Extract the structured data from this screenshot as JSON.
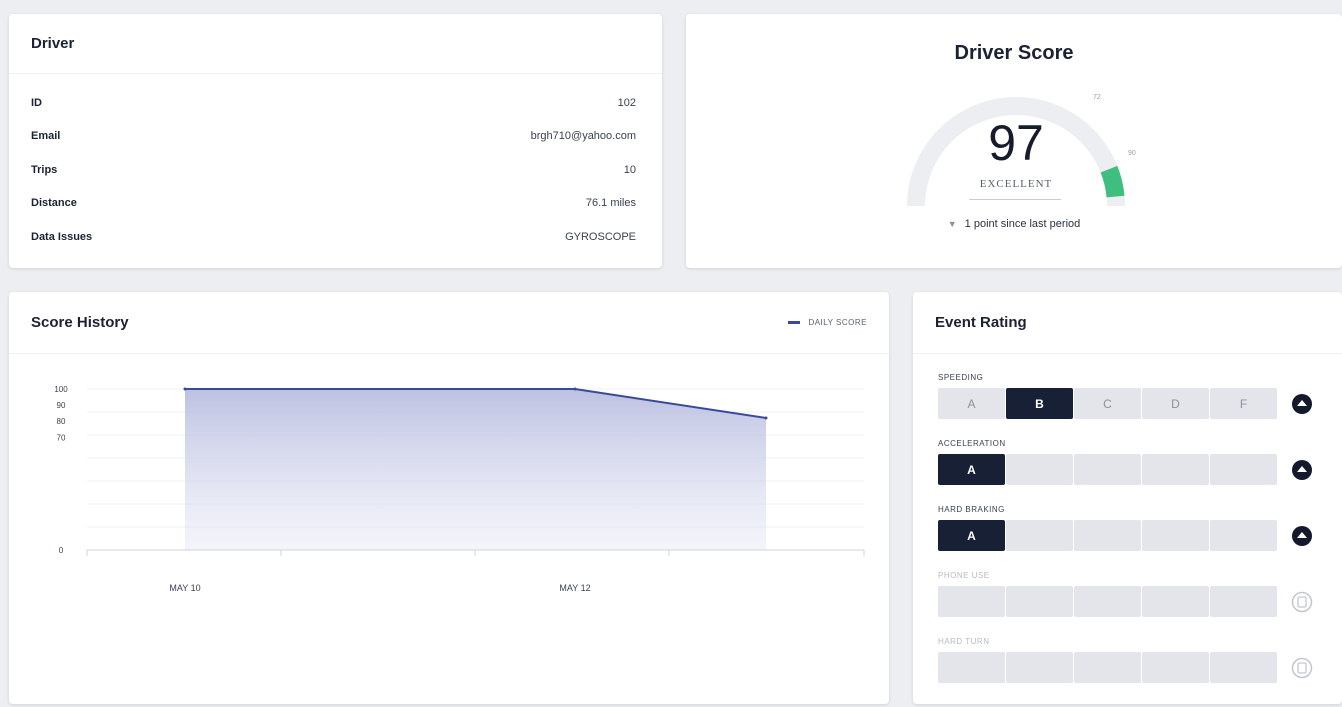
{
  "driver": {
    "title": "Driver",
    "rows": [
      {
        "label": "ID",
        "value": "102"
      },
      {
        "label": "Email",
        "value": "brgh710@yahoo.com"
      },
      {
        "label": "Trips",
        "value": "10"
      },
      {
        "label": "Distance",
        "value": "76.1 miles"
      },
      {
        "label": "Data Issues",
        "value": "GYROSCOPE"
      }
    ]
  },
  "driver_score": {
    "title": "Driver Score",
    "value": "97",
    "grade": "EXCELLENT",
    "change_text": "1 point since last period",
    "change_direction": "down",
    "gauge_ticks": [
      "72",
      "90"
    ],
    "gauge_level": 0.97,
    "colors": {
      "track": "#eceef1",
      "fill": "#3fbf7f"
    }
  },
  "score_history": {
    "title": "Score History",
    "legend": "DAILY SCORE",
    "colors": {
      "line": "#3a4a9a",
      "area": "#c9cde6"
    }
  },
  "chart_data": {
    "type": "area",
    "series": [
      {
        "name": "DAILY SCORE",
        "values": [
          100,
          100,
          82
        ]
      }
    ],
    "x": [
      "MAY 10",
      "MAY 12",
      ""
    ],
    "x_ticks": [
      "MAY 10",
      "MAY 12"
    ],
    "y_ticks": [
      "100",
      "90",
      "80",
      "70",
      "0"
    ],
    "ylim": [
      0,
      100
    ],
    "grid": true
  },
  "event_rating": {
    "title": "Event Rating",
    "events": [
      {
        "label": "SPEEDING",
        "grades": [
          "A",
          "B",
          "C",
          "D",
          "F"
        ],
        "active": 1,
        "disabled": false,
        "icon": "speeding-icon"
      },
      {
        "label": "ACCELERATION",
        "grades": [
          "A",
          "",
          "",
          "",
          ""
        ],
        "active": 0,
        "disabled": false,
        "icon": "acceleration-icon"
      },
      {
        "label": "HARD BRAKING",
        "grades": [
          "A",
          "",
          "",
          "",
          ""
        ],
        "active": 0,
        "disabled": false,
        "icon": "hard-braking-icon"
      },
      {
        "label": "PHONE USE",
        "grades": [
          "",
          "",
          "",
          "",
          ""
        ],
        "active": -1,
        "disabled": true,
        "icon": "phone-use-icon"
      },
      {
        "label": "HARD TURN",
        "grades": [
          "",
          "",
          "",
          "",
          ""
        ],
        "active": -1,
        "disabled": true,
        "icon": "hard-turn-icon"
      }
    ]
  }
}
